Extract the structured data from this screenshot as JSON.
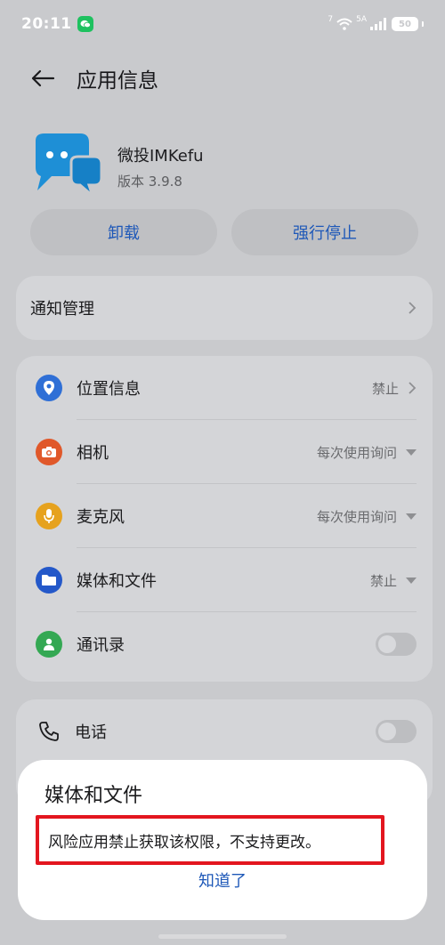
{
  "status_bar": {
    "time": "20:11",
    "wifi_label": "7",
    "signal_label": "5A",
    "battery": "50"
  },
  "header": {
    "title": "应用信息"
  },
  "app": {
    "name": "微投IMKefu",
    "version": "版本 3.9.8",
    "icon": "chat-bubbles-icon"
  },
  "actions": {
    "uninstall": "卸载",
    "force_stop": "强行停止"
  },
  "notification": {
    "label": "通知管理"
  },
  "permissions": [
    {
      "label": "位置信息",
      "value": "禁止",
      "icon": "location-icon",
      "color": "#2f6fd6",
      "control": "chevron"
    },
    {
      "label": "相机",
      "value": "每次使用询问",
      "icon": "camera-icon",
      "color": "#e0582a",
      "control": "dropdown"
    },
    {
      "label": "麦克风",
      "value": "每次使用询问",
      "icon": "microphone-icon",
      "color": "#e6a21e",
      "control": "dropdown"
    },
    {
      "label": "媒体和文件",
      "value": "禁止",
      "icon": "folder-icon",
      "color": "#2458c9",
      "control": "dropdown"
    },
    {
      "label": "通讯录",
      "value": "",
      "icon": "contacts-icon",
      "color": "#34a853",
      "control": "toggle",
      "enabled": false
    }
  ],
  "phone": {
    "label": "电话",
    "icon": "phone-icon",
    "enabled": false
  },
  "dialog": {
    "title": "媒体和文件",
    "message": "风险应用禁止获取该权限，不支持更改。",
    "confirm": "知道了"
  },
  "colors": {
    "accent": "#1e58b8",
    "highlight_border": "#e3161f",
    "app_icon": "#1e8fd6"
  }
}
